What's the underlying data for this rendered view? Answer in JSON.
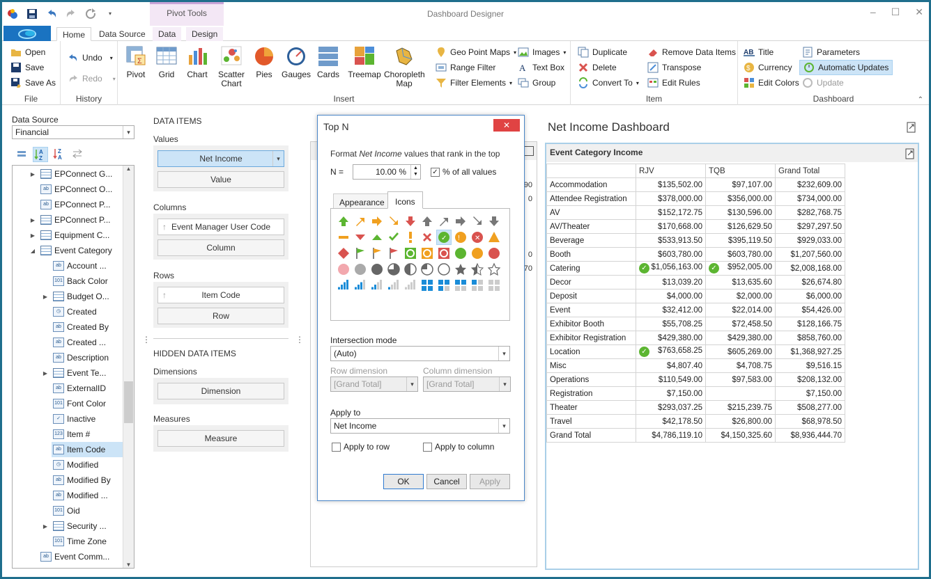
{
  "app_title": "Dashboard Designer",
  "context_tab_group": "Pivot Tools",
  "tabs": [
    "Home",
    "Data Source",
    "Data",
    "Design"
  ],
  "ribbon": {
    "file": {
      "label": "File",
      "open": "Open",
      "save": "Save",
      "save_as": "Save As"
    },
    "history": {
      "label": "History",
      "undo": "Undo",
      "redo": "Redo"
    },
    "insert": {
      "label": "Insert",
      "pivot": "Pivot",
      "grid": "Grid",
      "chart": "Chart",
      "scatter": "Scatter Chart",
      "pies": "Pies",
      "gauges": "Gauges",
      "cards": "Cards",
      "treemap": "Treemap",
      "choropleth": "Choropleth Map",
      "geo_point_maps": "Geo Point Maps",
      "range_filter": "Range Filter",
      "filter_elements": "Filter Elements",
      "images": "Images",
      "text_box": "Text Box",
      "group": "Group"
    },
    "item": {
      "label": "Item",
      "duplicate": "Duplicate",
      "delete": "Delete",
      "convert_to": "Convert To",
      "remove_data_items": "Remove Data Items",
      "transpose": "Transpose",
      "edit_rules": "Edit Rules"
    },
    "dashboard": {
      "label": "Dashboard",
      "title": "Title",
      "currency": "Currency",
      "edit_colors": "Edit Colors",
      "parameters": "Parameters",
      "automatic_updates": "Automatic Updates",
      "update": "Update"
    }
  },
  "data_source": {
    "label": "Data Source",
    "value": "Financial",
    "tree": [
      {
        "label": "EPConnect G...",
        "icon": "table",
        "level": 1,
        "expander": "closed"
      },
      {
        "label": "EPConnect O...",
        "icon": "ab",
        "level": 1,
        "expander": ""
      },
      {
        "label": "EPConnect P...",
        "icon": "ab",
        "level": 1,
        "expander": ""
      },
      {
        "label": "EPConnect P...",
        "icon": "table",
        "level": 1,
        "expander": "closed"
      },
      {
        "label": "Equipment C...",
        "icon": "table",
        "level": 1,
        "expander": "closed"
      },
      {
        "label": "Event Category",
        "icon": "table",
        "level": 1,
        "expander": "open"
      },
      {
        "label": "Account ...",
        "icon": "ab",
        "level": 2,
        "expander": ""
      },
      {
        "label": "Back Color",
        "icon": "101",
        "level": 2,
        "expander": ""
      },
      {
        "label": "Budget O...",
        "icon": "table",
        "level": 2,
        "expander": "closed"
      },
      {
        "label": "Created",
        "icon": "clock",
        "level": 2,
        "expander": ""
      },
      {
        "label": "Created By",
        "icon": "ab",
        "level": 2,
        "expander": ""
      },
      {
        "label": "Created ...",
        "icon": "ab",
        "level": 2,
        "expander": ""
      },
      {
        "label": "Description",
        "icon": "ab",
        "level": 2,
        "expander": ""
      },
      {
        "label": "Event Te...",
        "icon": "table",
        "level": 2,
        "expander": "closed"
      },
      {
        "label": "ExternalID",
        "icon": "ab",
        "level": 2,
        "expander": ""
      },
      {
        "label": "Font Color",
        "icon": "101",
        "level": 2,
        "expander": ""
      },
      {
        "label": "Inactive",
        "icon": "check",
        "level": 2,
        "expander": ""
      },
      {
        "label": "Item #",
        "icon": "123",
        "level": 2,
        "expander": ""
      },
      {
        "label": "Item Code",
        "icon": "ab",
        "level": 2,
        "expander": "",
        "selected": true
      },
      {
        "label": "Modified",
        "icon": "clock",
        "level": 2,
        "expander": ""
      },
      {
        "label": "Modified By",
        "icon": "ab",
        "level": 2,
        "expander": ""
      },
      {
        "label": "Modified ...",
        "icon": "ab",
        "level": 2,
        "expander": ""
      },
      {
        "label": "Oid",
        "icon": "101",
        "level": 2,
        "expander": ""
      },
      {
        "label": "Security ...",
        "icon": "table",
        "level": 2,
        "expander": "closed"
      },
      {
        "label": "Time Zone",
        "icon": "101",
        "level": 2,
        "expander": ""
      },
      {
        "label": "Event Comm...",
        "icon": "ab",
        "level": 1,
        "expander": ""
      }
    ]
  },
  "data_items": {
    "title": "DATA ITEMS",
    "values_label": "Values",
    "values_item": "Net Income",
    "values_placeholder": "Value",
    "columns_label": "Columns",
    "columns_item": "Event Manager User Code",
    "columns_placeholder": "Column",
    "rows_label": "Rows",
    "rows_item": "Item Code",
    "rows_placeholder": "Row",
    "hidden_title": "HIDDEN DATA ITEMS",
    "dimensions_label": "Dimensions",
    "dimensions_placeholder": "Dimension",
    "measures_label": "Measures",
    "measures_placeholder": "Measure"
  },
  "dialog": {
    "title": "Top N",
    "desc_prefix": "Format ",
    "desc_measure": "Net Income",
    "desc_suffix": " values that rank in the top",
    "n_label": "N =",
    "n_value": "10.00 %",
    "percent_label": "% of all values",
    "percent_checked": true,
    "tab_appearance": "Appearance",
    "tab_icons": "Icons",
    "intersection_label": "Intersection mode",
    "intersection_value": "(Auto)",
    "row_dim_label": "Row dimension",
    "row_dim_value": "[Grand Total]",
    "col_dim_label": "Column dimension",
    "col_dim_value": "[Grand Total]",
    "apply_to_label": "Apply to",
    "apply_to_value": "Net Income",
    "apply_row_label": "Apply to row",
    "apply_col_label": "Apply to column",
    "ok": "OK",
    "cancel": "Cancel",
    "apply": "Apply"
  },
  "dashboard": {
    "title": "Net Income Dashboard",
    "panel_title": "Event Category Income",
    "columns": [
      "",
      "RJV",
      "TQB",
      "Grand Total"
    ],
    "rows": [
      {
        "name": "Accommodation",
        "rjv": "$135,502.00",
        "tqb": "$97,107.00",
        "total": "$232,609.00"
      },
      {
        "name": "Attendee Registration",
        "rjv": "$378,000.00",
        "tqb": "$356,000.00",
        "total": "$734,000.00"
      },
      {
        "name": "AV",
        "rjv": "$152,172.75",
        "tqb": "$130,596.00",
        "total": "$282,768.75"
      },
      {
        "name": "AV/Theater",
        "rjv": "$170,668.00",
        "tqb": "$126,629.50",
        "total": "$297,297.50"
      },
      {
        "name": "Beverage",
        "rjv": "$533,913.50",
        "tqb": "$395,119.50",
        "total": "$929,033.00"
      },
      {
        "name": "Booth",
        "rjv": "$603,780.00",
        "tqb": "$603,780.00",
        "total": "$1,207,560.00"
      },
      {
        "name": "Catering",
        "rjv": "$1,056,163.00",
        "tqb": "$952,005.00",
        "total": "$2,008,168.00",
        "rjv_icon": true,
        "tqb_icon": true
      },
      {
        "name": "Decor",
        "rjv": "$13,039.20",
        "tqb": "$13,635.60",
        "total": "$26,674.80"
      },
      {
        "name": "Deposit",
        "rjv": "$4,000.00",
        "tqb": "$2,000.00",
        "total": "$6,000.00"
      },
      {
        "name": "Event",
        "rjv": "$32,412.00",
        "tqb": "$22,014.00",
        "total": "$54,426.00"
      },
      {
        "name": "Exhibitor Booth",
        "rjv": "$55,708.25",
        "tqb": "$72,458.50",
        "total": "$128,166.75"
      },
      {
        "name": "Exhibitor Registration",
        "rjv": "$429,380.00",
        "tqb": "$429,380.00",
        "total": "$858,760.00"
      },
      {
        "name": "Location",
        "rjv": "$763,658.25",
        "tqb": "$605,269.00",
        "total": "$1,368,927.25",
        "rjv_icon": true
      },
      {
        "name": "Misc",
        "rjv": "$4,807.40",
        "tqb": "$4,708.75",
        "total": "$9,516.15"
      },
      {
        "name": "Operations",
        "rjv": "$110,549.00",
        "tqb": "$97,583.00",
        "total": "$208,132.00"
      },
      {
        "name": "Registration",
        "rjv": "$7,150.00",
        "tqb": "",
        "total": "$7,150.00"
      },
      {
        "name": "Theater",
        "rjv": "$293,037.25",
        "tqb": "$215,239.75",
        "total": "$508,277.00"
      },
      {
        "name": "Travel",
        "rjv": "$42,178.50",
        "tqb": "$26,800.00",
        "total": "$68,978.50"
      },
      {
        "name": "Grand Total",
        "rjv": "$4,786,119.10",
        "tqb": "$4,150,325.60",
        "total": "$8,936,444.70"
      }
    ]
  },
  "background_item_values": [
    "90",
    "0",
    "0",
    "70"
  ],
  "colors": {
    "accent": "#1a73c1",
    "frame": "#1f6e8c",
    "selected": "#cce4f7",
    "ok_green": "#5cb531",
    "close_red": "#e04343"
  }
}
